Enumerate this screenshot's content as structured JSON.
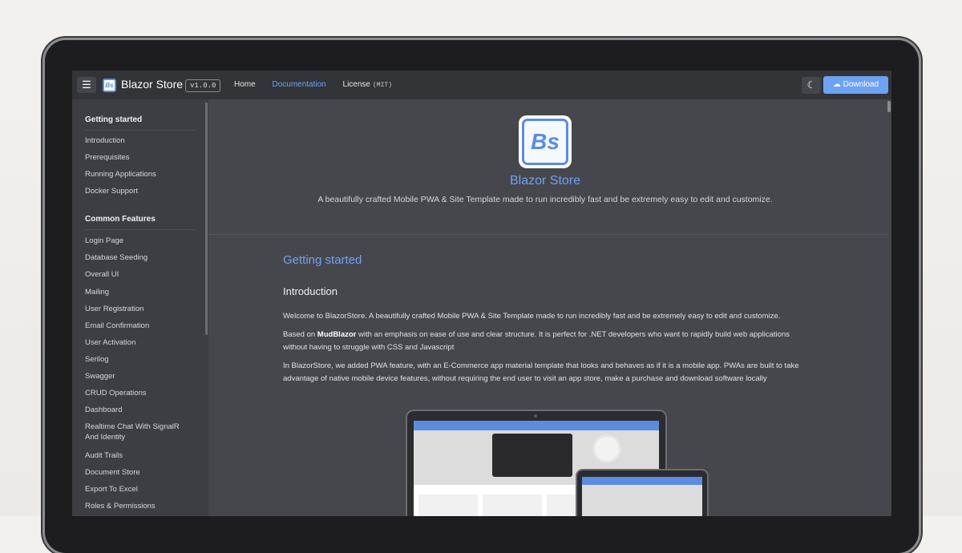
{
  "appbar": {
    "title": "Blazor Store",
    "logo_text": "Bs",
    "version": "v1.0.0",
    "nav": {
      "home": "Home",
      "documentation": "Documentation",
      "license": "License",
      "license_type": "(MIT)"
    },
    "download_label": "Download",
    "menu_icon": "menu-icon",
    "theme_icon": "moon-icon",
    "download_icon": "cloud-download-icon"
  },
  "sidebar": {
    "sections": [
      {
        "title": "Getting started",
        "items": [
          "Introduction",
          "Prerequisites",
          "Running Applications",
          "Docker Support"
        ]
      },
      {
        "title": "Common Features",
        "items": [
          "Login Page",
          "Database Seeding",
          "Overall UI",
          "Mailing",
          "User Registration",
          "Email Confirmation",
          "User Activation",
          "Serilog",
          "Swagger",
          "CRUD Operations",
          "Dashboard",
          "Realtime Chat With SignalR And Identity",
          "Audit Trails",
          "Document Store",
          "Export To Excel",
          "Roles & Permissions"
        ]
      }
    ]
  },
  "hero": {
    "logo_text": "Bs",
    "title": "Blazor Store",
    "subtitle": "A beautifully crafted Mobile PWA & Site Template made to run incredibly fast and be extremely easy to edit and customize."
  },
  "main": {
    "heading": "Getting started",
    "subheading": "Introduction",
    "para1": "Welcome to BlazorStore. A beautifully crafted Mobile PWA & Site Template made to run incredibly fast and be extremely easy to edit and customize.",
    "para2_prefix": "Based on ",
    "para2_bold": "MudBlazor",
    "para2_suffix": " with an emphasis on ease of use and clear structure. It is perfect for .NET developers who want to rapidly build web applications without having to struggle with CSS and Javascript",
    "para3": "In BlazorStore, we added PWA feature, with an E-Commerce app material template that looks and behaves as if it is a mobile app. PWAs are built to take advantage of native mobile device features, without requiring the end user to visit an app store, make a purchase and download software locally"
  },
  "colors": {
    "accent": "#6ea2f5",
    "appbar_bg": "#333438",
    "sidebar_bg": "#3d3e43",
    "content_bg": "#46474c"
  }
}
